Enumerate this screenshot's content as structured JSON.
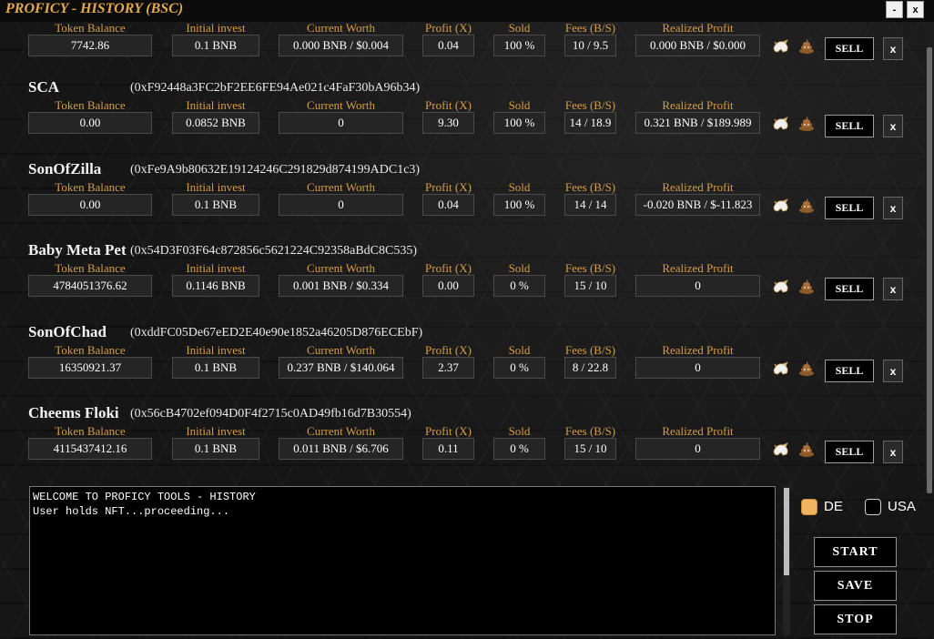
{
  "window": {
    "title": "PROFICY - HISTORY (BSC)",
    "minimize_label": "-",
    "close_label": "x"
  },
  "columns": [
    "Token Balance",
    "Initial invest",
    "Current Worth",
    "Profit (X)",
    "Sold",
    "Fees (B/S)",
    "Realized Profit"
  ],
  "tokens": [
    {
      "name": "",
      "address": "",
      "token_balance": "7742.86",
      "initial_invest": "0.1 BNB",
      "current_worth": "0.000 BNB / $0.004",
      "profit_x": "0.04",
      "sold": "100 %",
      "fees": "10 / 9.5",
      "realized_profit": "0.000 BNB / $0.000",
      "sell_label": "SELL",
      "remove_label": "x"
    },
    {
      "name": "SCA",
      "address": "(0xF92448a3FC2bF2EE6FE94Ae021c4FaF30bA96b34)",
      "token_balance": "0.00",
      "initial_invest": "0.0852 BNB",
      "current_worth": "0",
      "profit_x": "9.30",
      "sold": "100 %",
      "fees": "14 / 18.9",
      "realized_profit": "0.321 BNB / $189.989",
      "sell_label": "SELL",
      "remove_label": "x"
    },
    {
      "name": "SonOfZilla",
      "address": "(0xFe9A9b80632E19124246C291829d874199ADC1c3)",
      "token_balance": "0.00",
      "initial_invest": "0.1 BNB",
      "current_worth": "0",
      "profit_x": "0.04",
      "sold": "100 %",
      "fees": "14 / 14",
      "realized_profit": "-0.020 BNB / $-11.823",
      "sell_label": "SELL",
      "remove_label": "x"
    },
    {
      "name": "Baby Meta Pet",
      "address": "(0x54D3F03F64c872856c5621224C92358aBdC8C535)",
      "token_balance": "4784051376.62",
      "initial_invest": "0.1146 BNB",
      "current_worth": "0.001 BNB / $0.334",
      "profit_x": "0.00",
      "sold": "0 %",
      "fees": "15 / 10",
      "realized_profit": "0",
      "sell_label": "SELL",
      "remove_label": "x"
    },
    {
      "name": "SonOfChad",
      "address": "(0xddFC05De67eED2E40e90e1852a46205D876ECEbF)",
      "token_balance": "16350921.37",
      "initial_invest": "0.1 BNB",
      "current_worth": "0.237 BNB / $140.064",
      "profit_x": "2.37",
      "sold": "0 %",
      "fees": "8 / 22.8",
      "realized_profit": "0",
      "sell_label": "SELL",
      "remove_label": "x"
    },
    {
      "name": "Cheems Floki",
      "address": "(0x56cB4702ef094D0F4f2715c0AD49fb16d7B30554)",
      "token_balance": "4115437412.16",
      "initial_invest": "0.1 BNB",
      "current_worth": "0.011 BNB / $6.706",
      "profit_x": "0.11",
      "sold": "0 %",
      "fees": "15 / 10",
      "realized_profit": "0",
      "sell_label": "SELL",
      "remove_label": "x"
    }
  ],
  "icons": {
    "bull": "bull-icon",
    "poo": "poo-icon"
  },
  "log": {
    "lines": [
      "WELCOME TO PROFICY TOOLS - HISTORY",
      "",
      "User holds NFT...proceeding..."
    ]
  },
  "currency": {
    "options": [
      {
        "label": "DE",
        "selected": true
      },
      {
        "label": "USA",
        "selected": false
      }
    ]
  },
  "actions": {
    "start": "START",
    "save": "SAVE",
    "stop": "STOP"
  },
  "colors": {
    "accent": "#e2a94e",
    "label": "#d79d46",
    "field_bg": "#252525",
    "radio_selected": "#f0b360"
  }
}
